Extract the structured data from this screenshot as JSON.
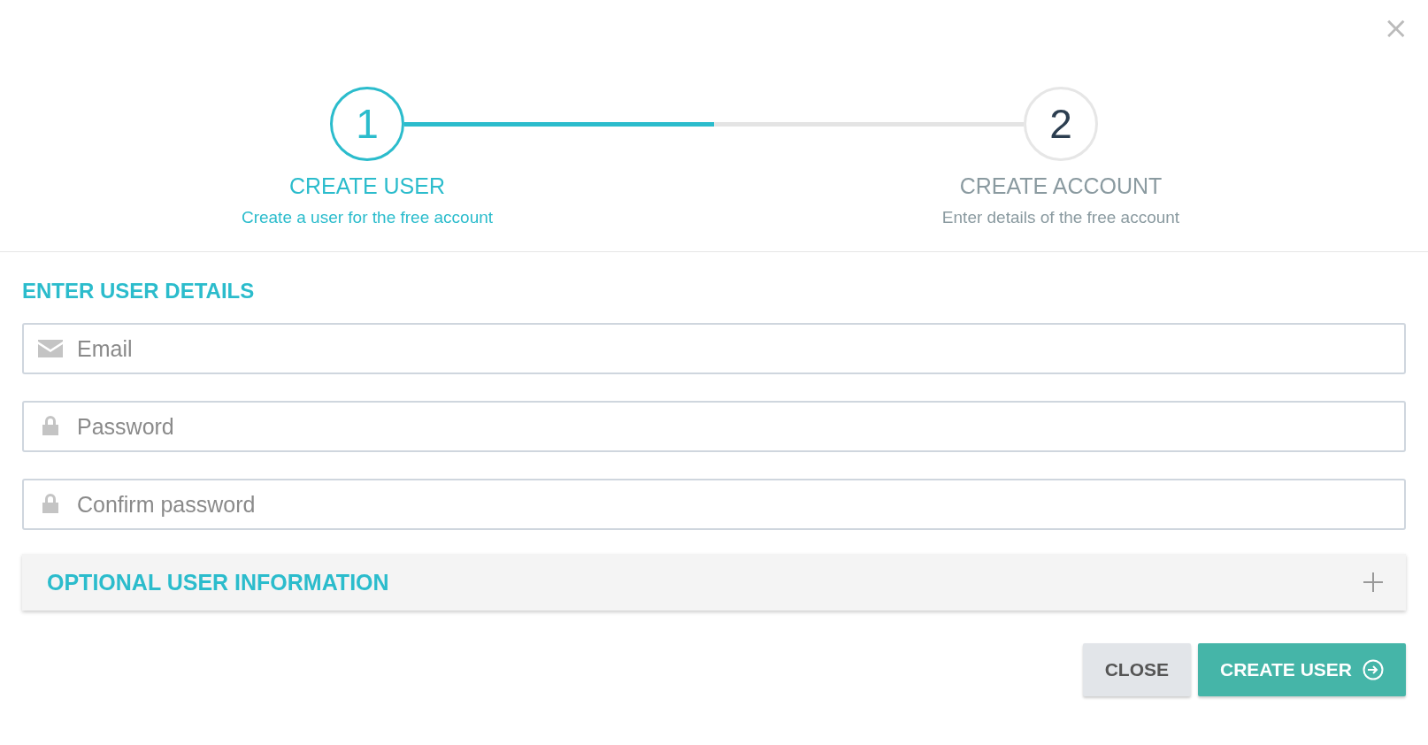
{
  "close_icon": "×",
  "steps": [
    {
      "number": "1",
      "title": "CREATE USER",
      "subtitle": "Create a user for the free account",
      "selected": true
    },
    {
      "number": "2",
      "title": "CREATE ACCOUNT",
      "subtitle": "Enter details of the free account",
      "selected": false
    }
  ],
  "progress": {
    "level": 0.5
  },
  "section_title": "ENTER USER DETAILS",
  "fields": [
    {
      "kind": "email",
      "placeholder": "Email"
    },
    {
      "kind": "password",
      "placeholder": "Password"
    },
    {
      "kind": "password",
      "placeholder": "Confirm password"
    }
  ],
  "optional_panel": {
    "title": "OPTIONAL USER INFORMATION",
    "expanded": false
  },
  "buttons": [
    {
      "kind": "secondary",
      "label": "CLOSE"
    },
    {
      "kind": "primary",
      "label": "CREATE USER"
    }
  ]
}
